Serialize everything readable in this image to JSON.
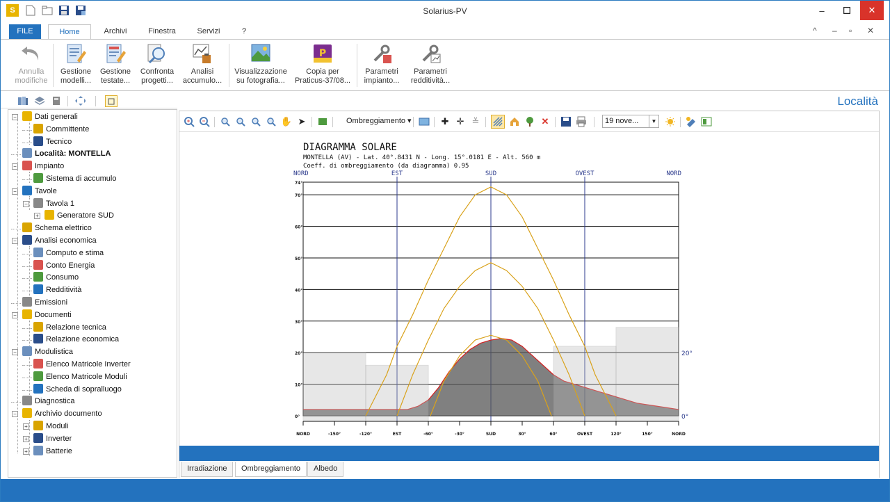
{
  "window": {
    "title": "Solarius-PV"
  },
  "ribbon_tabs": [
    {
      "label": "FILE"
    },
    {
      "label": "Home"
    },
    {
      "label": "Archivi"
    },
    {
      "label": "Finestra"
    },
    {
      "label": "Servizi"
    },
    {
      "label": "?"
    }
  ],
  "ribbon": {
    "annulla": [
      "Annulla",
      "modifiche"
    ],
    "gestione_modelli": [
      "Gestione",
      "modelli..."
    ],
    "gestione_testate": [
      "Gestione",
      "testate..."
    ],
    "confronta": [
      "Confronta",
      "progetti..."
    ],
    "analisi": [
      "Analisi",
      "accumulo..."
    ],
    "visualizzazione": [
      "Visualizzazione",
      "su fotografia..."
    ],
    "copia": [
      "Copia per",
      "Praticus-37/08..."
    ],
    "param_impianto": [
      "Parametri",
      "impianto..."
    ],
    "param_redd": [
      "Parametri",
      "redditività..."
    ]
  },
  "location_label": "Località",
  "tree": [
    {
      "label": "Dati generali",
      "depth": 0
    },
    {
      "label": "Committente",
      "depth": 1
    },
    {
      "label": "Tecnico",
      "depth": 1
    },
    {
      "label": "Località: MONTELLA",
      "depth": 0
    },
    {
      "label": "Impianto",
      "depth": 0
    },
    {
      "label": "Sistema di accumulo",
      "depth": 1
    },
    {
      "label": "Tavole",
      "depth": 0
    },
    {
      "label": "Tavola 1",
      "depth": 1
    },
    {
      "label": "Generatore SUD",
      "depth": 2
    },
    {
      "label": "Schema elettrico",
      "depth": 0
    },
    {
      "label": "Analisi economica",
      "depth": 0
    },
    {
      "label": "Computo e stima",
      "depth": 1
    },
    {
      "label": "Conto Energia",
      "depth": 1
    },
    {
      "label": "Consumo",
      "depth": 1
    },
    {
      "label": "Redditività",
      "depth": 1
    },
    {
      "label": "Emissioni",
      "depth": 0
    },
    {
      "label": "Documenti",
      "depth": 0
    },
    {
      "label": "Relazione tecnica",
      "depth": 1
    },
    {
      "label": "Relazione economica",
      "depth": 1
    },
    {
      "label": "Modulistica",
      "depth": 0
    },
    {
      "label": "Elenco Matricole Inverter",
      "depth": 1
    },
    {
      "label": "Elenco Matricole Moduli",
      "depth": 1
    },
    {
      "label": "Scheda di sopralluogo",
      "depth": 1
    },
    {
      "label": "Diagnostica",
      "depth": 0
    },
    {
      "label": "Archivio documento",
      "depth": 0
    },
    {
      "label": "Moduli",
      "depth": 1
    },
    {
      "label": "Inverter",
      "depth": 1
    },
    {
      "label": "Batterie",
      "depth": 1
    }
  ],
  "toolbar": {
    "ombreggiamento": "Ombreggiamento",
    "date": "19 nove..."
  },
  "bottom_tabs": [
    {
      "label": "Irradiazione"
    },
    {
      "label": "Ombreggiamento"
    },
    {
      "label": "Albedo"
    }
  ],
  "chart_data": {
    "type": "line",
    "title": "DIAGRAMMA SOLARE",
    "subtitle": "MONTELLA (AV) - Lat. 40°.8431 N - Long. 15°.0181 E - Alt. 560 m",
    "coefficient": "Coeff. di ombreggiamento (da diagramma) 0.95",
    "top_labels": [
      "NORD",
      "EST",
      "SUD",
      "OVEST",
      "NORD"
    ],
    "y_ticks": [
      "74°",
      "70°",
      "60°",
      "50°",
      "40°",
      "30°",
      "20°",
      "10°",
      "0°"
    ],
    "y_tick_values": [
      74,
      70,
      60,
      50,
      40,
      30,
      20,
      10,
      0
    ],
    "x_ticks": [
      "NORD",
      "-150°",
      "-120°",
      "EST",
      "-60°",
      "-30°",
      "SUD",
      "30°",
      "60°",
      "OVEST",
      "120°",
      "150°",
      "NORD"
    ],
    "x_tick_values": [
      -180,
      -150,
      -120,
      -90,
      -60,
      -30,
      0,
      30,
      60,
      90,
      120,
      150,
      180
    ],
    "side_labels": [
      "20°",
      "0°"
    ],
    "xlim": [
      -180,
      180
    ],
    "ylim": [
      0,
      74
    ],
    "series": [
      {
        "x": [
          -120,
          -100,
          -90,
          -75,
          -60,
          -45,
          -30,
          -15,
          0,
          15,
          30,
          45,
          60,
          75,
          90,
          100,
          120
        ],
        "y": [
          0,
          13,
          22,
          32,
          43,
          53,
          63,
          70,
          72.5,
          70,
          63,
          53,
          43,
          32,
          22,
          13,
          0
        ]
      },
      {
        "x": [
          -90,
          -75,
          -60,
          -45,
          -30,
          -15,
          0,
          15,
          30,
          45,
          60,
          75,
          90
        ],
        "y": [
          0,
          13,
          24,
          34,
          41,
          46,
          48.5,
          46,
          41,
          34,
          24,
          13,
          0
        ]
      },
      {
        "x": [
          -58,
          -45,
          -30,
          -15,
          0,
          15,
          30,
          45,
          58
        ],
        "y": [
          0,
          11,
          19,
          24,
          25.5,
          24,
          19,
          11,
          0
        ]
      }
    ],
    "skyline": {
      "x": [
        -180,
        -160,
        -140,
        -120,
        -100,
        -80,
        -70,
        -60,
        -50,
        -40,
        -30,
        -20,
        -10,
        0,
        10,
        20,
        30,
        40,
        50,
        60,
        70,
        80,
        90,
        100,
        120,
        140,
        160,
        180
      ],
      "y": [
        2,
        2,
        2,
        2,
        2,
        2,
        3,
        5,
        9,
        14,
        18,
        21,
        23,
        24,
        24.5,
        24,
        22,
        19,
        16,
        13,
        11,
        10,
        9,
        8,
        6,
        4,
        3,
        2
      ]
    },
    "grid": true
  }
}
